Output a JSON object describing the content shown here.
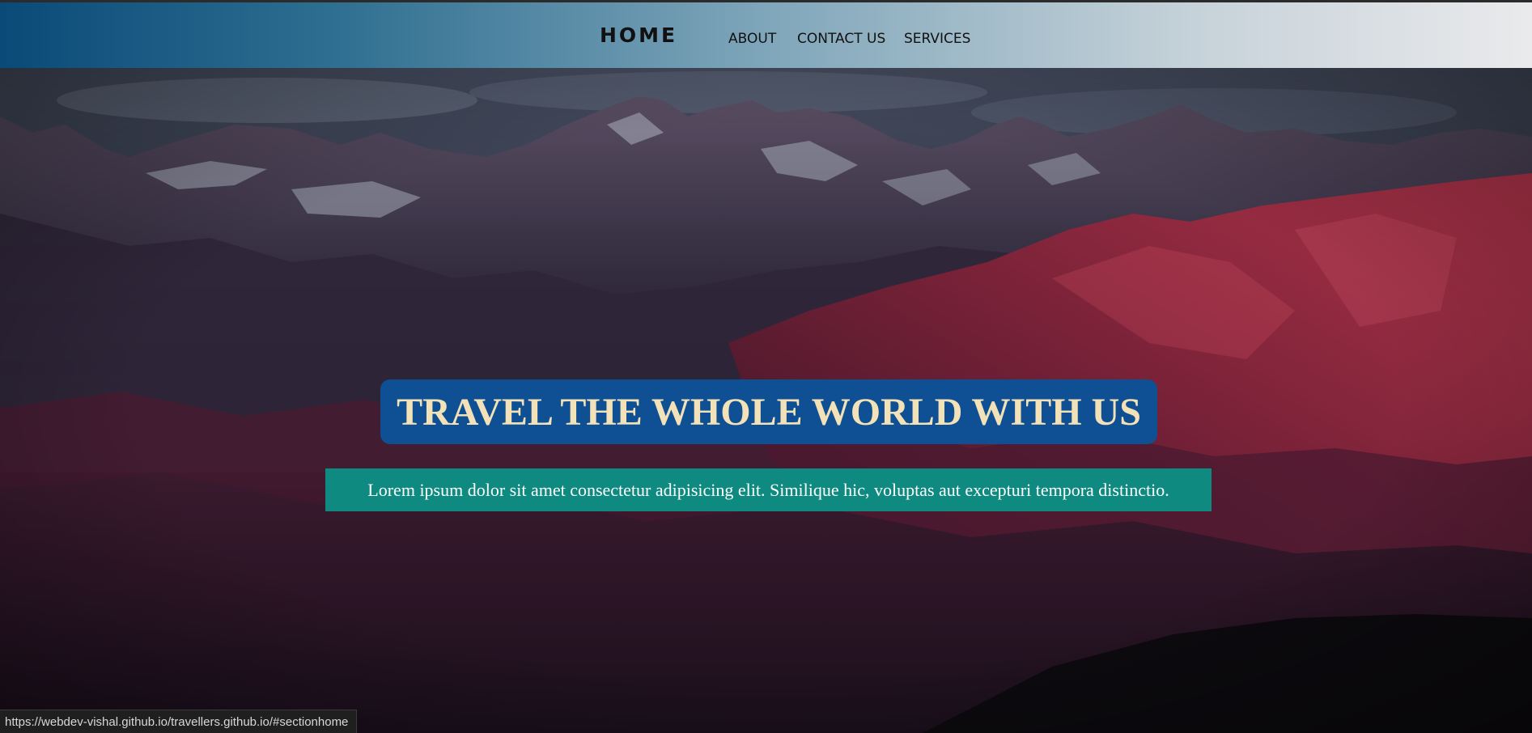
{
  "nav": {
    "logo": "HOME",
    "links": [
      {
        "label": "ABOUT"
      },
      {
        "label": "CONTACT US"
      },
      {
        "label": "SERVICES"
      }
    ],
    "gradient_colors": [
      "#0a4a78",
      "#eaeaec"
    ]
  },
  "hero": {
    "headline": "TRAVEL THE WHOLE WORLD WITH US",
    "subtext": "Lorem ipsum dolor sit amet consectetur adipisicing elit. Similique hic, voluptas aut excepturi tempora distinctio.",
    "headline_bg": "#0f4f93",
    "headline_color": "#f3e2b8",
    "subtext_bg": "#0e8a80",
    "background_image": "mountain range at dusk with red-lit slopes"
  },
  "status_bar": {
    "url": "https://webdev-vishal.github.io/travellers.github.io/#sectionhome"
  }
}
